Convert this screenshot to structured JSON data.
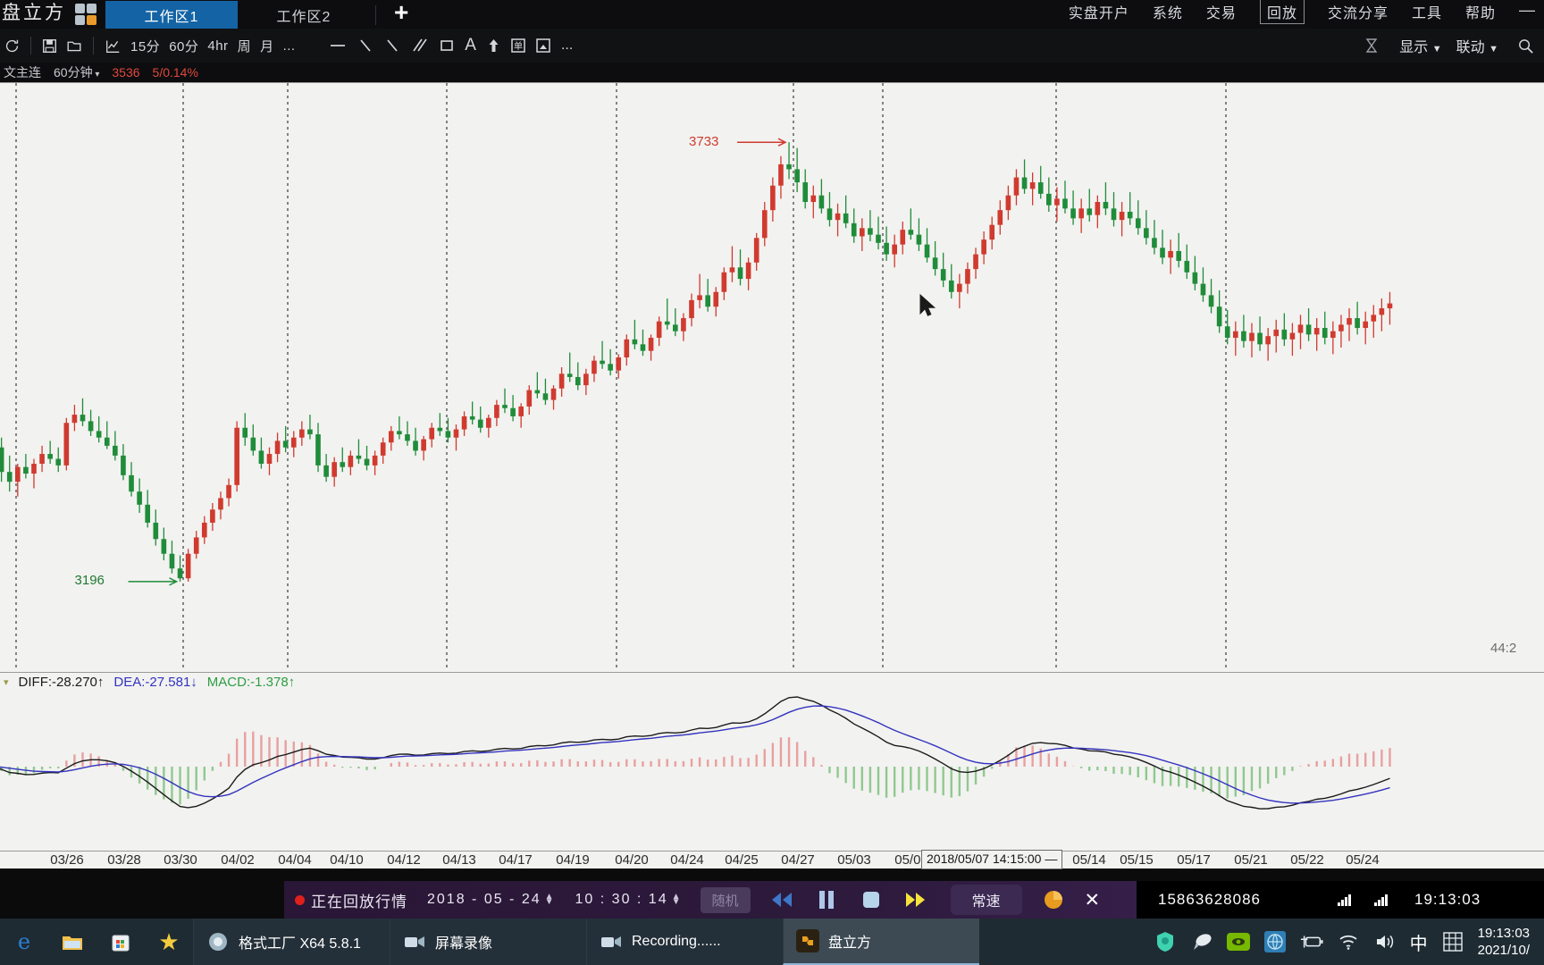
{
  "titlebar": {
    "brand": "盘立方",
    "logo_icon": "grid-logo-icon",
    "tabs": [
      {
        "label": "工作区1",
        "active": true
      },
      {
        "label": "工作区2",
        "active": false
      }
    ],
    "add_tab_icon": "plus-icon",
    "menu": [
      "实盘开户",
      "系统",
      "交易",
      "回放",
      "交流分享",
      "工具",
      "帮助"
    ],
    "active_menu": "回放",
    "window_minimize_icon": "minimize-icon"
  },
  "toolbar": {
    "refresh_icon": "refresh-icon",
    "save_icon": "save-icon",
    "open_icon": "folder-open-icon",
    "chart_icon": "line-chart-icon",
    "periods": [
      "15分",
      "60分",
      "4hr",
      "周",
      "月",
      "..."
    ],
    "draw_tools": [
      "horizontal-line-icon",
      "trend-line-icon",
      "ray-line-icon",
      "parallel-channel-icon",
      "rectangle-icon",
      "text-icon",
      "arrow-up-icon",
      "label-icon",
      "image-icon",
      "more-icon"
    ],
    "right": {
      "alarm_icon": "alarm-icon",
      "display_label": "显示",
      "link_label": "联动",
      "search_icon": "search-icon"
    }
  },
  "quotebar": {
    "symbol": "文主连",
    "period": "60分钟",
    "period_caret_icon": "chevron-down-icon",
    "last_price": "3536",
    "change": "5/0.14%"
  },
  "chart_data": {
    "type": "candlestick",
    "title": "文主连 60分钟",
    "xlabel": "",
    "ylabel": "",
    "grid": true,
    "high_label": "3733",
    "low_label": "3196",
    "right_label": "44:2",
    "ylim": [
      3150,
      3790
    ],
    "x_ticks": [
      "03/26",
      "03/28",
      "03/30",
      "04/02",
      "04/04",
      "04/10",
      "04/12",
      "04/13",
      "04/17",
      "04/19",
      "04/20",
      "04/24",
      "04/25",
      "04/27",
      "05/03",
      "05/07",
      "05/14",
      "05/15",
      "05/17",
      "05/21",
      "05/22",
      "05/24"
    ],
    "crosshair_tooltip": "2018/05/07 14:15:00 —",
    "up_color": "#d03a2f",
    "down_color": "#1f8c3a",
    "candles": [
      [
        3380,
        3402,
        3352,
        3360
      ],
      [
        3360,
        3372,
        3318,
        3330
      ],
      [
        3330,
        3350,
        3306,
        3318
      ],
      [
        3318,
        3340,
        3300,
        3336
      ],
      [
        3336,
        3352,
        3322,
        3328
      ],
      [
        3328,
        3346,
        3310,
        3340
      ],
      [
        3340,
        3362,
        3330,
        3352
      ],
      [
        3352,
        3368,
        3340,
        3346
      ],
      [
        3346,
        3360,
        3330,
        3338
      ],
      [
        3338,
        3396,
        3332,
        3390
      ],
      [
        3390,
        3412,
        3380,
        3400
      ],
      [
        3400,
        3420,
        3386,
        3392
      ],
      [
        3392,
        3406,
        3374,
        3380
      ],
      [
        3380,
        3398,
        3366,
        3372
      ],
      [
        3372,
        3392,
        3358,
        3362
      ],
      [
        3362,
        3380,
        3344,
        3350
      ],
      [
        3350,
        3364,
        3320,
        3326
      ],
      [
        3326,
        3342,
        3300,
        3306
      ],
      [
        3306,
        3322,
        3280,
        3290
      ],
      [
        3290,
        3308,
        3262,
        3268
      ],
      [
        3268,
        3284,
        3240,
        3248
      ],
      [
        3248,
        3262,
        3222,
        3230
      ],
      [
        3230,
        3246,
        3206,
        3212
      ],
      [
        3212,
        3228,
        3196,
        3200
      ],
      [
        3200,
        3236,
        3196,
        3230
      ],
      [
        3230,
        3258,
        3224,
        3250
      ],
      [
        3250,
        3276,
        3242,
        3268
      ],
      [
        3268,
        3292,
        3258,
        3284
      ],
      [
        3284,
        3306,
        3272,
        3298
      ],
      [
        3298,
        3322,
        3288,
        3314
      ],
      [
        3314,
        3392,
        3306,
        3384
      ],
      [
        3384,
        3402,
        3362,
        3372
      ],
      [
        3372,
        3388,
        3350,
        3356
      ],
      [
        3356,
        3372,
        3334,
        3340
      ],
      [
        3340,
        3360,
        3326,
        3352
      ],
      [
        3352,
        3378,
        3342,
        3368
      ],
      [
        3368,
        3386,
        3354,
        3360
      ],
      [
        3360,
        3380,
        3348,
        3372
      ],
      [
        3372,
        3392,
        3362,
        3382
      ],
      [
        3382,
        3400,
        3370,
        3376
      ],
      [
        3376,
        3390,
        3330,
        3338
      ],
      [
        3338,
        3352,
        3318,
        3324
      ],
      [
        3324,
        3348,
        3312,
        3342
      ],
      [
        3342,
        3360,
        3330,
        3336
      ],
      [
        3336,
        3356,
        3326,
        3350
      ],
      [
        3350,
        3370,
        3340,
        3346
      ],
      [
        3346,
        3362,
        3332,
        3338
      ],
      [
        3338,
        3356,
        3326,
        3350
      ],
      [
        3350,
        3372,
        3340,
        3366
      ],
      [
        3366,
        3386,
        3356,
        3380
      ],
      [
        3380,
        3398,
        3370,
        3376
      ],
      [
        3376,
        3392,
        3362,
        3368
      ],
      [
        3368,
        3384,
        3350,
        3356
      ],
      [
        3356,
        3374,
        3344,
        3370
      ],
      [
        3370,
        3390,
        3360,
        3384
      ],
      [
        3384,
        3402,
        3374,
        3380
      ],
      [
        3380,
        3396,
        3366,
        3372
      ],
      [
        3372,
        3388,
        3356,
        3382
      ],
      [
        3382,
        3404,
        3374,
        3398
      ],
      [
        3398,
        3416,
        3388,
        3394
      ],
      [
        3394,
        3410,
        3378,
        3384
      ],
      [
        3384,
        3400,
        3372,
        3396
      ],
      [
        3396,
        3418,
        3386,
        3412
      ],
      [
        3412,
        3432,
        3402,
        3408
      ],
      [
        3408,
        3424,
        3392,
        3398
      ],
      [
        3398,
        3414,
        3384,
        3410
      ],
      [
        3410,
        3436,
        3400,
        3430
      ],
      [
        3430,
        3452,
        3420,
        3426
      ],
      [
        3426,
        3444,
        3412,
        3418
      ],
      [
        3418,
        3436,
        3406,
        3432
      ],
      [
        3432,
        3458,
        3422,
        3450
      ],
      [
        3450,
        3476,
        3440,
        3446
      ],
      [
        3446,
        3464,
        3430,
        3436
      ],
      [
        3436,
        3456,
        3424,
        3450
      ],
      [
        3450,
        3472,
        3440,
        3466
      ],
      [
        3466,
        3490,
        3456,
        3462
      ],
      [
        3462,
        3480,
        3448,
        3454
      ],
      [
        3454,
        3474,
        3444,
        3470
      ],
      [
        3470,
        3498,
        3460,
        3492
      ],
      [
        3492,
        3516,
        3480,
        3486
      ],
      [
        3486,
        3504,
        3472,
        3478
      ],
      [
        3478,
        3498,
        3466,
        3494
      ],
      [
        3494,
        3520,
        3484,
        3514
      ],
      [
        3514,
        3542,
        3504,
        3510
      ],
      [
        3510,
        3530,
        3496,
        3502
      ],
      [
        3502,
        3524,
        3490,
        3518
      ],
      [
        3518,
        3548,
        3508,
        3540
      ],
      [
        3540,
        3572,
        3530,
        3546
      ],
      [
        3546,
        3566,
        3526,
        3532
      ],
      [
        3532,
        3556,
        3520,
        3550
      ],
      [
        3550,
        3580,
        3540,
        3574
      ],
      [
        3574,
        3606,
        3562,
        3580
      ],
      [
        3580,
        3602,
        3558,
        3566
      ],
      [
        3566,
        3592,
        3552,
        3586
      ],
      [
        3586,
        3622,
        3576,
        3616
      ],
      [
        3616,
        3660,
        3606,
        3650
      ],
      [
        3650,
        3690,
        3636,
        3680
      ],
      [
        3680,
        3716,
        3664,
        3706
      ],
      [
        3706,
        3733,
        3688,
        3700
      ],
      [
        3700,
        3726,
        3672,
        3684
      ],
      [
        3684,
        3700,
        3652,
        3660
      ],
      [
        3660,
        3680,
        3640,
        3668
      ],
      [
        3668,
        3688,
        3646,
        3652
      ],
      [
        3652,
        3672,
        3630,
        3638
      ],
      [
        3638,
        3658,
        3618,
        3646
      ],
      [
        3646,
        3668,
        3628,
        3634
      ],
      [
        3634,
        3652,
        3610,
        3618
      ],
      [
        3618,
        3640,
        3600,
        3628
      ],
      [
        3628,
        3650,
        3612,
        3620
      ],
      [
        3620,
        3642,
        3602,
        3610
      ],
      [
        3610,
        3630,
        3588,
        3596
      ],
      [
        3596,
        3620,
        3580,
        3608
      ],
      [
        3608,
        3636,
        3596,
        3626
      ],
      [
        3626,
        3652,
        3614,
        3620
      ],
      [
        3620,
        3640,
        3600,
        3608
      ],
      [
        3608,
        3628,
        3586,
        3592
      ],
      [
        3592,
        3612,
        3570,
        3578
      ],
      [
        3578,
        3598,
        3556,
        3564
      ],
      [
        3564,
        3584,
        3542,
        3550
      ],
      [
        3550,
        3572,
        3530,
        3560
      ],
      [
        3560,
        3586,
        3548,
        3578
      ],
      [
        3578,
        3604,
        3566,
        3596
      ],
      [
        3596,
        3624,
        3584,
        3614
      ],
      [
        3614,
        3642,
        3602,
        3632
      ],
      [
        3632,
        3662,
        3620,
        3650
      ],
      [
        3650,
        3680,
        3638,
        3668
      ],
      [
        3668,
        3700,
        3656,
        3690
      ],
      [
        3690,
        3712,
        3670,
        3676
      ],
      [
        3676,
        3696,
        3656,
        3684
      ],
      [
        3684,
        3704,
        3664,
        3670
      ],
      [
        3670,
        3690,
        3648,
        3656
      ],
      [
        3656,
        3678,
        3636,
        3664
      ],
      [
        3664,
        3686,
        3646,
        3652
      ],
      [
        3652,
        3674,
        3632,
        3640
      ],
      [
        3640,
        3664,
        3622,
        3652
      ],
      [
        3652,
        3676,
        3636,
        3644
      ],
      [
        3644,
        3668,
        3628,
        3660
      ],
      [
        3660,
        3684,
        3644,
        3652
      ],
      [
        3652,
        3672,
        3630,
        3638
      ],
      [
        3638,
        3660,
        3618,
        3648
      ],
      [
        3648,
        3672,
        3632,
        3640
      ],
      [
        3640,
        3662,
        3620,
        3628
      ],
      [
        3628,
        3650,
        3608,
        3616
      ],
      [
        3616,
        3638,
        3596,
        3604
      ],
      [
        3604,
        3626,
        3584,
        3592
      ],
      [
        3592,
        3614,
        3572,
        3600
      ],
      [
        3600,
        3622,
        3580,
        3588
      ],
      [
        3588,
        3608,
        3566,
        3574
      ],
      [
        3574,
        3594,
        3552,
        3560
      ],
      [
        3560,
        3580,
        3538,
        3546
      ],
      [
        3546,
        3566,
        3524,
        3532
      ],
      [
        3532,
        3552,
        3500,
        3508
      ],
      [
        3508,
        3528,
        3486,
        3494
      ],
      [
        3494,
        3514,
        3472,
        3502
      ],
      [
        3502,
        3522,
        3482,
        3490
      ],
      [
        3490,
        3512,
        3470,
        3500
      ],
      [
        3500,
        3520,
        3478,
        3486
      ],
      [
        3486,
        3506,
        3466,
        3496
      ],
      [
        3496,
        3516,
        3476,
        3504
      ],
      [
        3504,
        3524,
        3484,
        3492
      ],
      [
        3492,
        3512,
        3472,
        3500
      ],
      [
        3500,
        3522,
        3480,
        3510
      ],
      [
        3510,
        3530,
        3490,
        3498
      ],
      [
        3498,
        3518,
        3478,
        3506
      ],
      [
        3506,
        3526,
        3486,
        3494
      ],
      [
        3494,
        3514,
        3474,
        3502
      ],
      [
        3502,
        3522,
        3482,
        3510
      ],
      [
        3510,
        3530,
        3490,
        3518
      ],
      [
        3518,
        3538,
        3498,
        3506
      ],
      [
        3506,
        3526,
        3486,
        3514
      ],
      [
        3514,
        3534,
        3494,
        3522
      ],
      [
        3522,
        3542,
        3502,
        3530
      ],
      [
        3530,
        3550,
        3510,
        3536
      ]
    ]
  },
  "macd_data": {
    "type": "macd",
    "diff_label": "DIFF:-28.270↑",
    "dea_label": "DEA:-27.581↓",
    "macd_label": "MACD:-1.378↑",
    "diff_value": -28.27,
    "dea_value": -27.581,
    "macd_value": -1.378,
    "caret_icon": "chevron-down-icon",
    "diff_color": "#1b1b1b",
    "dea_color": "#3333c0",
    "hist_up_color": "#e8a0a0",
    "hist_down_color": "#8fc98f"
  },
  "playback": {
    "status_dot_icon": "record-dot-icon",
    "status_label": "正在回放行情",
    "date": "2018 - 05 - 24",
    "time": "10 : 30 : 14",
    "random_label": "随机",
    "rewind_icon": "rewind-icon",
    "pause_icon": "pause-icon",
    "stop_icon": "stop-icon",
    "fastforward_icon": "fast-forward-icon",
    "speed_label": "常速",
    "pie_icon": "pie-chart-icon",
    "close_icon": "close-icon",
    "phone": "15863628086",
    "signal_icon": "signal-bars-icon",
    "clock": "19:13:03"
  },
  "taskbar": {
    "quicklaunch": [
      {
        "icon": "edge-icon",
        "label": ""
      },
      {
        "icon": "file-explorer-icon",
        "label": ""
      },
      {
        "icon": "microsoft-store-icon",
        "label": ""
      },
      {
        "icon": "star-icon",
        "label": ""
      }
    ],
    "windows": [
      {
        "icon": "format-factory-icon",
        "label": "格式工厂 X64 5.8.1",
        "active": false
      },
      {
        "icon": "screen-recorder-icon",
        "label": "屏幕录像",
        "active": false
      },
      {
        "icon": "recording-icon",
        "label": "Recording......",
        "active": false
      },
      {
        "icon": "panlifang-icon",
        "label": "盘立方",
        "active": true
      }
    ],
    "tray": [
      "shield-icon",
      "mouse-icon",
      "nvidia-icon",
      "network-globe-icon",
      "battery-icon",
      "wifi-icon",
      "volume-icon"
    ],
    "ime": "中",
    "ime_mode_icon": "pinyin-icon",
    "time": "19:13:03",
    "date": "2021/10/"
  }
}
